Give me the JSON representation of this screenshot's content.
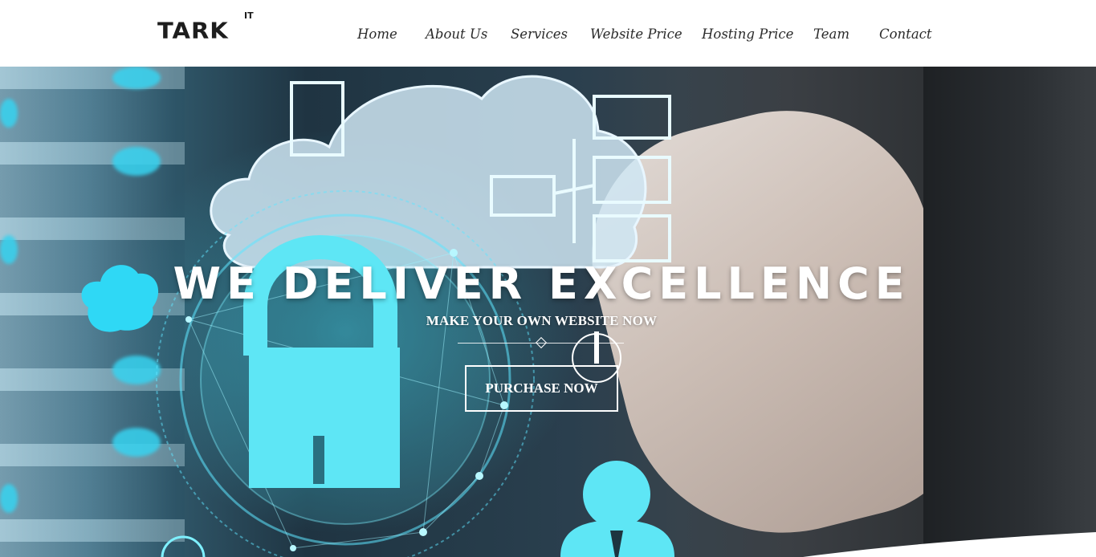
{
  "brand": {
    "logo_text": "TARK",
    "logo_sup": "IT"
  },
  "nav": {
    "items": [
      {
        "label": "Home"
      },
      {
        "label": "About Us"
      },
      {
        "label": "Services"
      },
      {
        "label": "Website Price"
      },
      {
        "label": "Hosting Price"
      },
      {
        "label": "Team"
      },
      {
        "label": "Contact"
      }
    ]
  },
  "hero": {
    "title": "WE DELIVER EXCELLENCE",
    "subtitle": "MAKE YOUR OWN WEBSITE NOW",
    "cta_label": "PURCHASE NOW",
    "background_icons": [
      "cloud-icon",
      "lock-icon",
      "monitor-icon",
      "user-icon"
    ]
  },
  "colors": {
    "header_bg": "#ffffff",
    "nav_text": "#2b2b2b",
    "accent_cyan": "#37d3f0",
    "hero_text": "#ffffff"
  }
}
